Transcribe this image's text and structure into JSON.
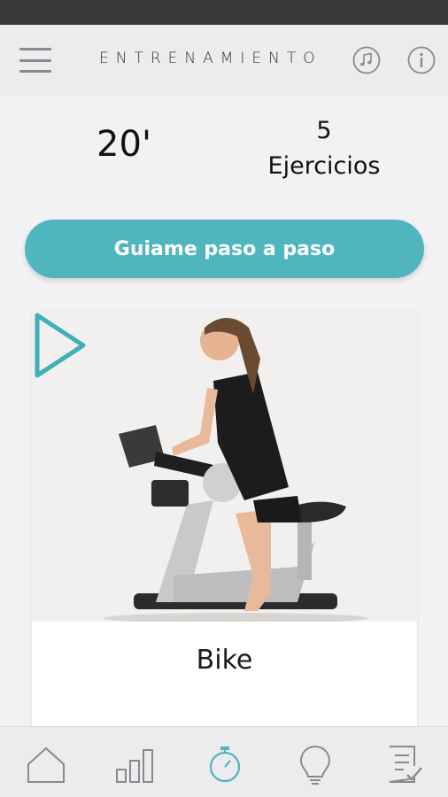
{
  "header": {
    "title": "ENTRENAMIENTO",
    "menu_icon": "hamburger-menu-icon",
    "music_icon": "music-note-icon",
    "info_icon": "info-icon"
  },
  "summary": {
    "duration": "20'",
    "exercise_count": "5",
    "exercise_label": "Ejercicios"
  },
  "guide_button": {
    "label": "Guiame paso a paso"
  },
  "exercise_card": {
    "title": "Bike",
    "play_icon": "play-icon"
  },
  "bottom_nav": {
    "items": [
      {
        "icon": "home-icon",
        "active": false
      },
      {
        "icon": "stats-icon",
        "active": false
      },
      {
        "icon": "stopwatch-icon",
        "active": true
      },
      {
        "icon": "lightbulb-icon",
        "active": false
      },
      {
        "icon": "checklist-icon",
        "active": false
      }
    ]
  },
  "colors": {
    "accent": "#4fb6bf",
    "icon_gray": "#8a8a8e",
    "background": "#f2f2f5"
  }
}
